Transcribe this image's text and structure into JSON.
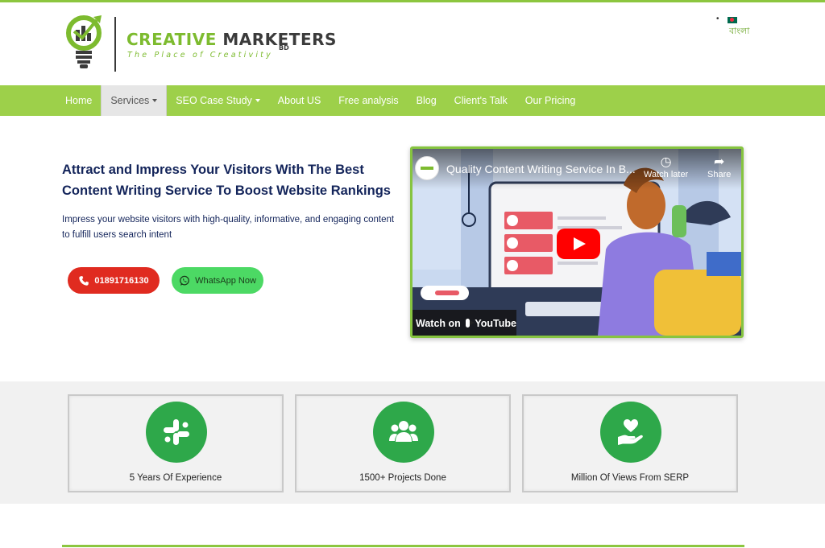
{
  "brand": {
    "name_part1": "CREATIVE",
    "name_part2": "MARKETERS",
    "suffix": "BD",
    "tagline": "The Place of Creativity"
  },
  "language": {
    "label": "বাংলা",
    "flag_icon": "bangladesh-flag-icon"
  },
  "nav": {
    "items": [
      {
        "label": "Home",
        "has_dropdown": false,
        "active": false
      },
      {
        "label": "Services",
        "has_dropdown": true,
        "active": true
      },
      {
        "label": "SEO Case Study",
        "has_dropdown": true,
        "active": false
      },
      {
        "label": "About US",
        "has_dropdown": false,
        "active": false
      },
      {
        "label": "Free analysis",
        "has_dropdown": false,
        "active": false
      },
      {
        "label": "Blog",
        "has_dropdown": false,
        "active": false
      },
      {
        "label": "Client's Talk",
        "has_dropdown": false,
        "active": false
      },
      {
        "label": "Our Pricing",
        "has_dropdown": false,
        "active": false
      }
    ]
  },
  "hero": {
    "title": "Attract and Impress Your Visitors With The Best Content Writing Service To Boost Website Rankings",
    "description": "Impress your website visitors with high-quality, informative, and engaging content to fulfill users search intent",
    "phone_button": "01891716130",
    "whatsapp_button": "WhatsApp Now"
  },
  "video": {
    "title": "Quality Content Writing Service In B...",
    "watch_later": "Watch later",
    "share": "Share",
    "watch_on": "Watch on",
    "platform": "YouTube"
  },
  "stats": [
    {
      "label": "5 Years Of Experience",
      "icon": "slack-icon"
    },
    {
      "label": "1500+ Projects Done",
      "icon": "users-icon"
    },
    {
      "label": "Million Of Views From SERP",
      "icon": "hand-heart-icon"
    }
  ],
  "colors": {
    "brand_green": "#8cc63f",
    "nav_green": "#9dd04a",
    "navy": "#13245a",
    "phone_red": "#e02b20",
    "whatsapp_green": "#4cd964",
    "stat_circle": "#2ea84a"
  }
}
